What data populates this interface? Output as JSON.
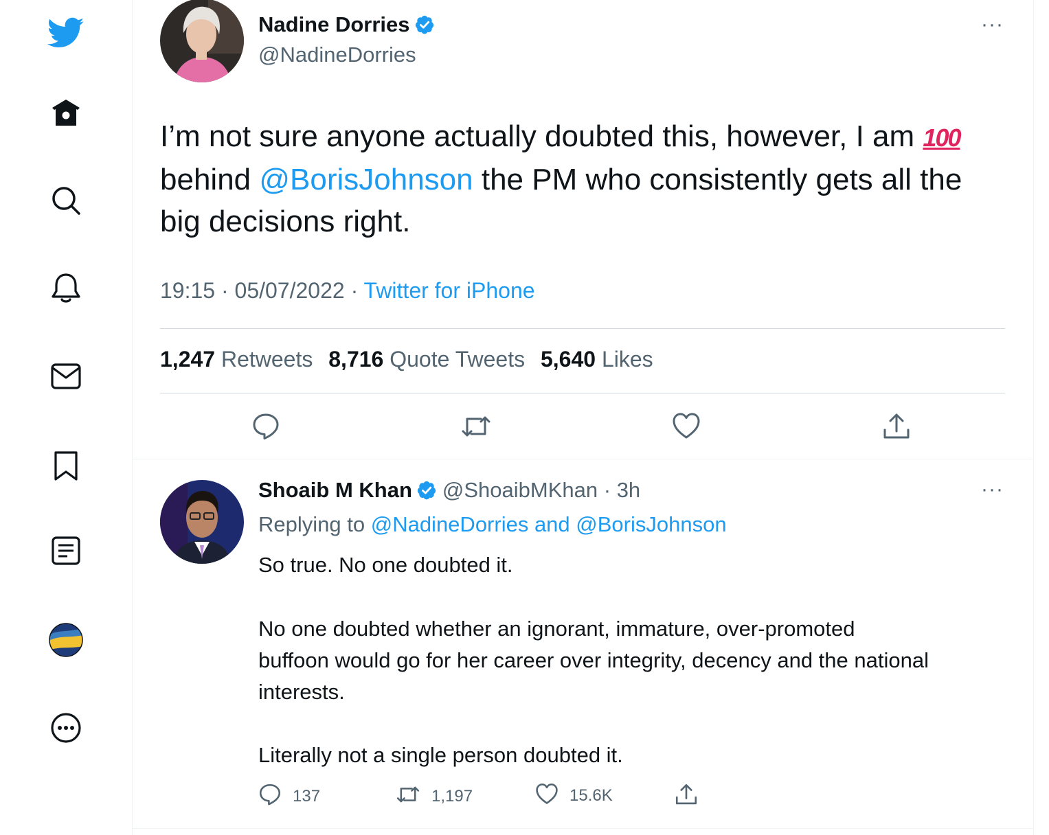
{
  "sidebar": {
    "items": [
      {
        "icon": "twitter-logo-icon"
      },
      {
        "icon": "home-icon"
      },
      {
        "icon": "explore-search-icon"
      },
      {
        "icon": "notifications-bell-icon"
      },
      {
        "icon": "messages-mail-icon"
      },
      {
        "icon": "bookmarks-icon"
      },
      {
        "icon": "lists-icon"
      },
      {
        "icon": "profile-avatar-icon"
      },
      {
        "icon": "more-options-icon"
      }
    ],
    "accent_color": "#1d9bf0"
  },
  "main_tweet": {
    "author_name": "Nadine Dorries",
    "author_handle": "@NadineDorries",
    "more": "···",
    "text_line1": "I’m not sure anyone actually doubted this, however, I am",
    "emoji": "💯",
    "text_line2_pre": "behind ",
    "text_line2_mention": "@BorisJohnson",
    "text_line2_post": " the PM who consistently gets all the",
    "text_line3": "big decisions right.",
    "time": "19:15",
    "date": "05/07/2022",
    "separator": "·",
    "source": "Twitter for iPhone",
    "retweets_count": "1,247",
    "retweets_label": "Retweets",
    "quote_count": "8,716",
    "quote_label": "Quote Tweets",
    "likes_count": "5,640",
    "likes_label": "Likes"
  },
  "reply_tweet": {
    "author_name": "Shoaib M Khan",
    "author_handle": "@ShoaibMKhan",
    "time_ago": "3h",
    "separator": "·",
    "more": "···",
    "replying_prefix": "Replying to ",
    "replying_mentions": "@NadineDorries and @BorisJohnson",
    "line1": "So true. No one doubted it.",
    "line2": "No one doubted whether an ignorant, immature, over-promoted",
    "line3": "buffoon would go for her career over integrity, decency and the national",
    "line4": "interests.",
    "line5": "Literally not a single person doubted it.",
    "reply_count": "137",
    "retweet_count": "1,197",
    "like_count": "15.6K"
  }
}
